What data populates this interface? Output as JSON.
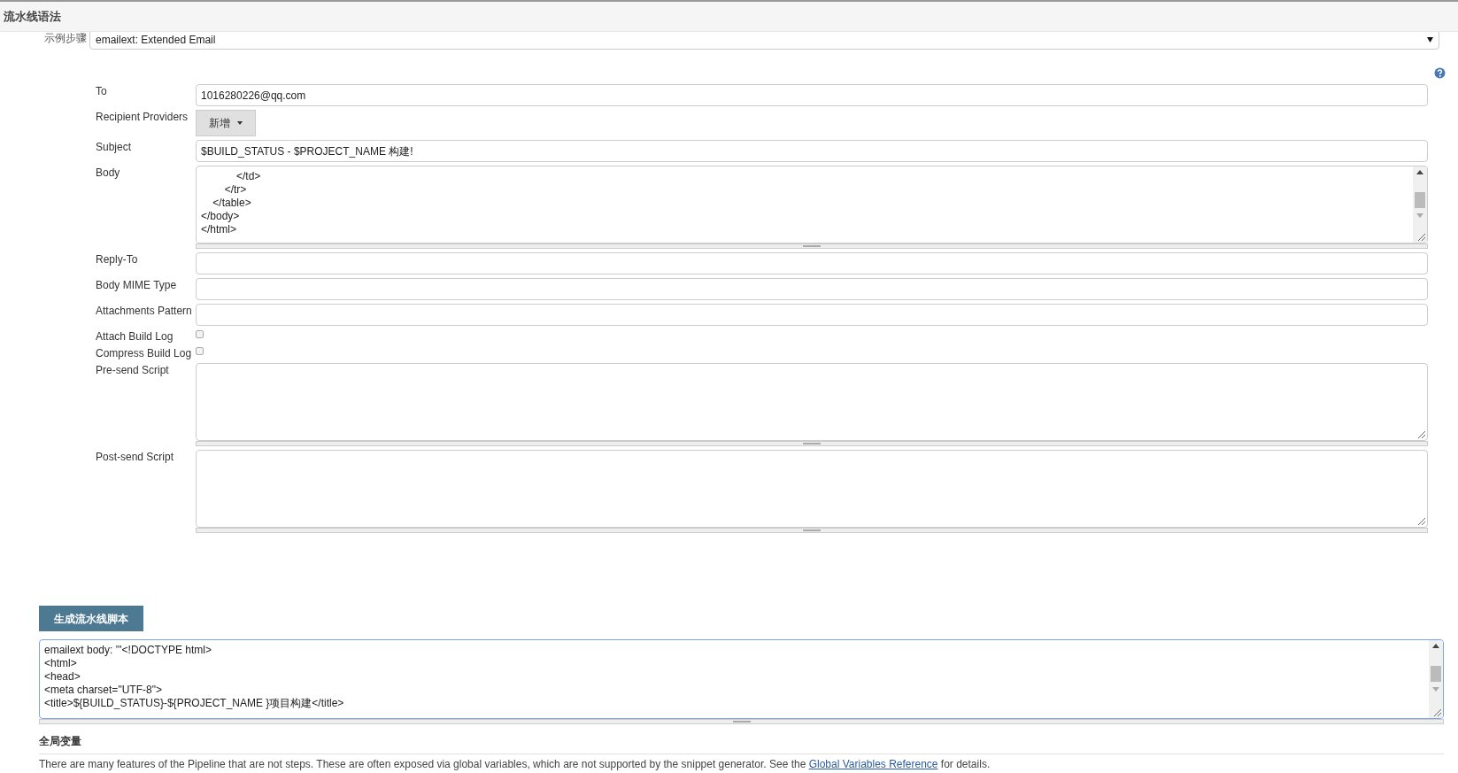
{
  "header": {
    "title": "流水线语法"
  },
  "sample_step": {
    "label": "示例步骤",
    "value": "emailext: Extended Email"
  },
  "fields": [
    {
      "kind": "text",
      "label": "To",
      "value": "1016280226@qq.com"
    },
    {
      "kind": "dropdown-button",
      "label": "Recipient Providers",
      "button": "新增"
    },
    {
      "kind": "text",
      "label": "Subject",
      "value": "$BUILD_STATUS - $PROJECT_NAME 构建!"
    },
    {
      "kind": "textarea",
      "label": "Body",
      "lines": [
        "            </td>",
        "        </tr>",
        "    </table>",
        "</body>",
        "</html>"
      ]
    },
    {
      "kind": "text",
      "label": "Reply-To"
    },
    {
      "kind": "text",
      "label": "Body MIME Type"
    },
    {
      "kind": "text",
      "label": "Attachments Pattern"
    },
    {
      "kind": "checkbox",
      "label": "Attach Build Log",
      "checked": false
    },
    {
      "kind": "checkbox",
      "label": "Compress Build Log",
      "checked": false
    },
    {
      "kind": "textarea",
      "label": "Pre-send Script"
    },
    {
      "kind": "textarea",
      "label": "Post-send Script"
    }
  ],
  "generate_button": "生成流水线脚本",
  "output": {
    "lines": [
      "emailext body: '''<!DOCTYPE html>",
      "<html>",
      "<head>",
      "<meta charset=\"UTF-8\">",
      "<title>${BUILD_STATUS}-${PROJECT_NAME }项目构建</title>"
    ]
  },
  "global_variables": {
    "title": "全局变量",
    "text_before": "There are many features of the Pipeline that are not steps. These are often exposed via global variables, which are not supported by the snippet generator. See the ",
    "link": "Global Variables Reference",
    "text_after": " for details."
  }
}
